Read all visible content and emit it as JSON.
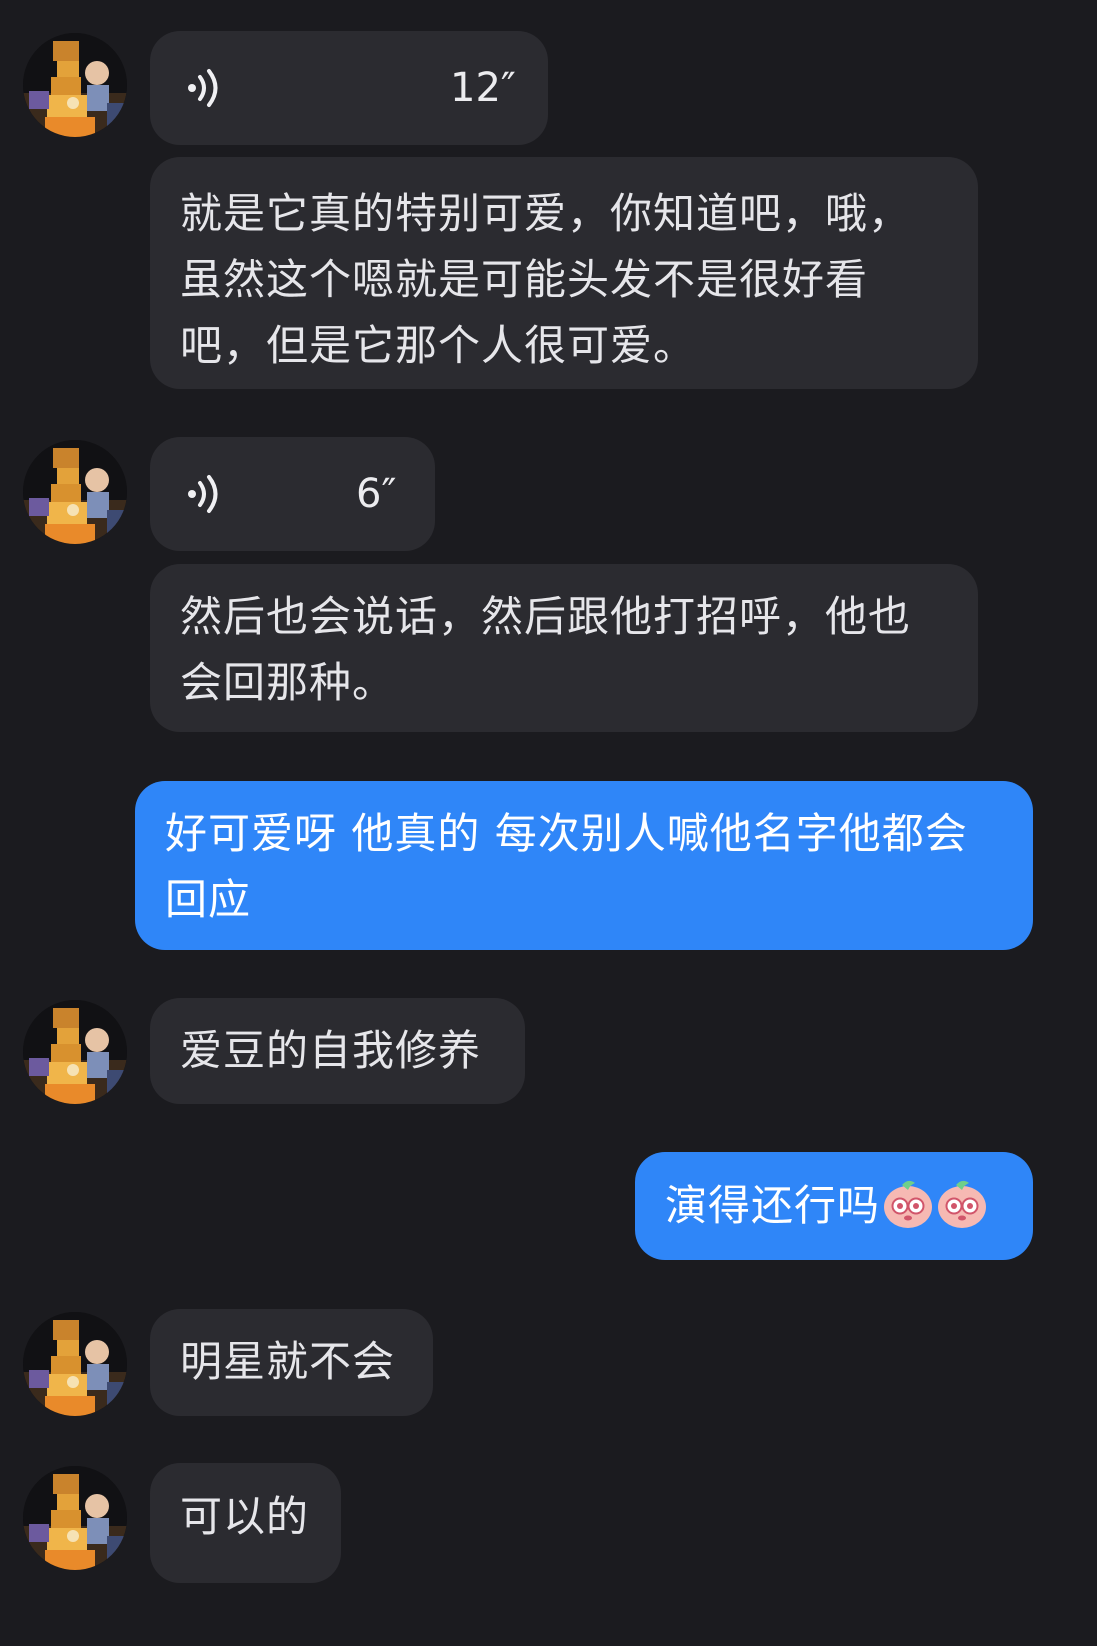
{
  "messages": [
    {
      "from": "contact",
      "kind": "voice",
      "duration": "12″"
    },
    {
      "from": "contact",
      "kind": "text",
      "text": "就是它真的特别可爱，你知道吧，哦，\n虽然这个嗯就是可能头发不是很好看\n吧，但是它那个人很可爱。"
    },
    {
      "from": "contact",
      "kind": "voice",
      "duration": "6″"
    },
    {
      "from": "contact",
      "kind": "text",
      "text": "然后也会说话，然后跟他打招呼，他也\n会回那种。"
    },
    {
      "from": "me",
      "kind": "text",
      "text": "好可爱呀 他真的 每次别人喊他名字他都会\n回应"
    },
    {
      "from": "contact",
      "kind": "text",
      "text": "爱豆的自我修养"
    },
    {
      "from": "me",
      "kind": "text",
      "text": "演得还行吗",
      "emoji": [
        "peach-face-emoji",
        "peach-face-emoji"
      ]
    },
    {
      "from": "contact",
      "kind": "text",
      "text": "明星就不会"
    },
    {
      "from": "contact",
      "kind": "text",
      "text": "可以的"
    }
  ],
  "colors": {
    "background": "#1b1b1f",
    "incoming_bubble": "#2b2b30",
    "outgoing_bubble": "#2f86f8",
    "text": "#e6e6ea"
  }
}
